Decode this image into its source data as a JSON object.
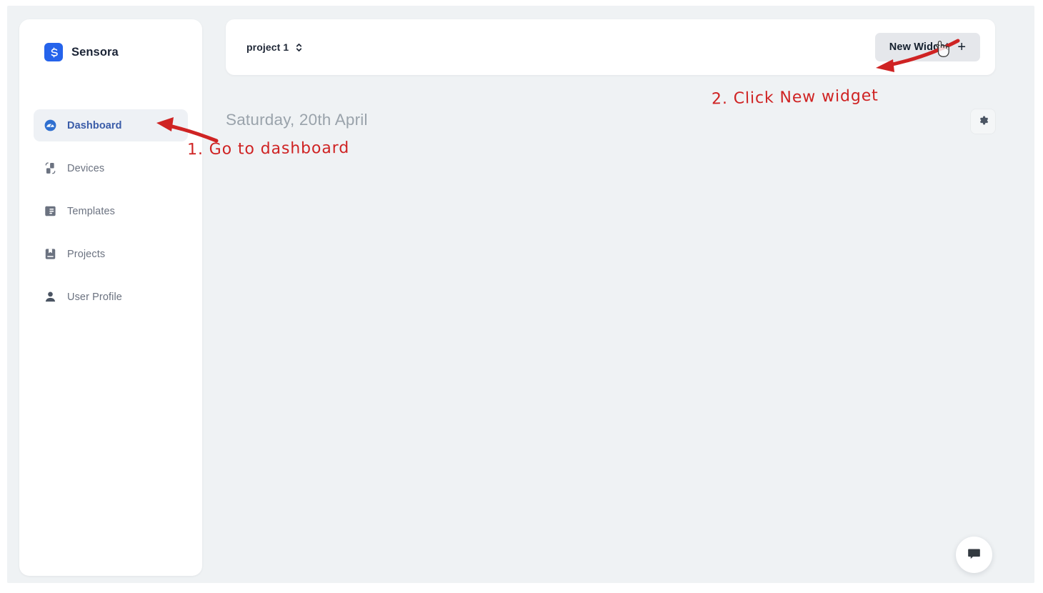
{
  "app": {
    "brand_name": "Sensora",
    "brand_icon": "sensora-logo-icon"
  },
  "sidebar": {
    "items": [
      {
        "label": "Dashboard",
        "icon": "gauge-icon",
        "active": true,
        "name": "dashboard"
      },
      {
        "label": "Devices",
        "icon": "devices-icon",
        "active": false,
        "name": "devices"
      },
      {
        "label": "Templates",
        "icon": "template-icon",
        "active": false,
        "name": "templates"
      },
      {
        "label": "Projects",
        "icon": "book-icon",
        "active": false,
        "name": "projects"
      },
      {
        "label": "User Profile",
        "icon": "user-icon",
        "active": false,
        "name": "user-profile"
      }
    ]
  },
  "topbar": {
    "project_selected": "project 1",
    "project_chevron_icon": "up-down-chevron-icon",
    "new_widget_label": "New Widget",
    "new_widget_plus_icon": "plus-icon"
  },
  "content": {
    "date_heading": "Saturday, 20th April",
    "settings_icon": "gear-icon",
    "chat_icon": "chat-bubble-icon"
  },
  "annotations": [
    {
      "id": "1",
      "text": "1. Go to dashboard",
      "color": "#cf2323"
    },
    {
      "id": "2",
      "text": "2. Click New widget",
      "color": "#cf2323"
    }
  ],
  "cursor": {
    "icon": "hand-pointer-cursor"
  },
  "colors": {
    "accent_blue": "#2563eb",
    "active_nav_text": "#3a5ca8",
    "annotation_red": "#cf2323",
    "canvas": "#eff2f4",
    "card": "#ffffff"
  }
}
